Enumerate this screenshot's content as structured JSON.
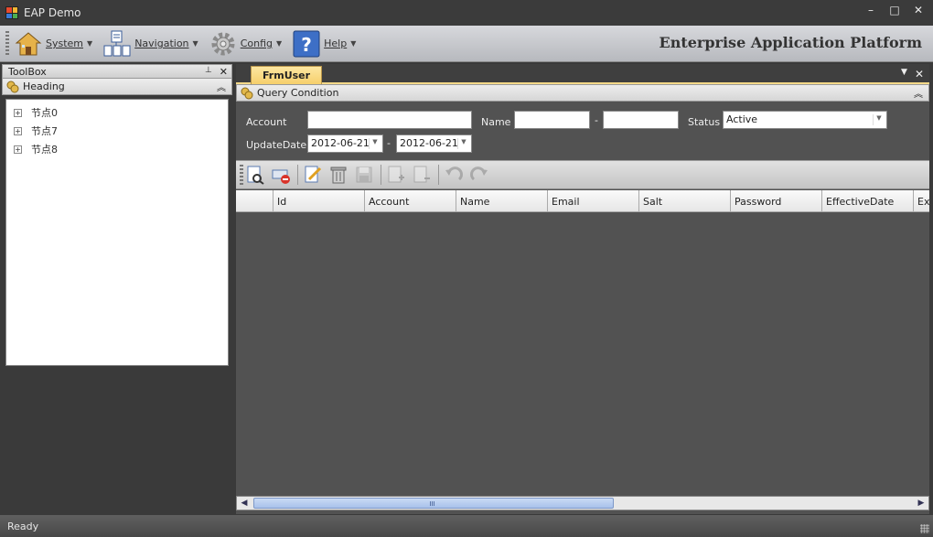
{
  "window": {
    "title": "EAP Demo",
    "controls": [
      "–",
      "□",
      "✕"
    ]
  },
  "menu": {
    "items": [
      {
        "label": "System",
        "icon": "house-icon"
      },
      {
        "label": "Navigation",
        "icon": "documents-tree-icon"
      },
      {
        "label": "Config",
        "icon": "gear-icon"
      },
      {
        "label": "Help",
        "icon": "help-question-icon"
      }
    ],
    "brand": "Enterprise Application Platform"
  },
  "toolbox": {
    "title": "ToolBox",
    "pin": "📌",
    "close": "✕",
    "heading": "Heading",
    "nodes": [
      "节点0",
      "节点7",
      "节点8"
    ]
  },
  "document": {
    "tab": "FrmUser",
    "query": {
      "title": "Query Condition",
      "account_label": "Account",
      "account_value": "",
      "name_label": "Name",
      "name_from": "",
      "range_sep": "-",
      "name_to": "",
      "status_label": "Status",
      "status_value": "Active",
      "updatedate_label": "UpdateDate",
      "date_from": "2012-06-21",
      "date_to": "2012-06-21"
    },
    "grid": {
      "columns": [
        "",
        "Id",
        "Account",
        "Name",
        "Email",
        "Salt",
        "Password",
        "EffectiveDate",
        "Ex"
      ]
    }
  },
  "status": {
    "text": "Ready"
  },
  "colors": {
    "tab_accent": "#f6cf6b",
    "panel_dark": "#525252",
    "scroll_thumb": "#a8c1eb"
  }
}
